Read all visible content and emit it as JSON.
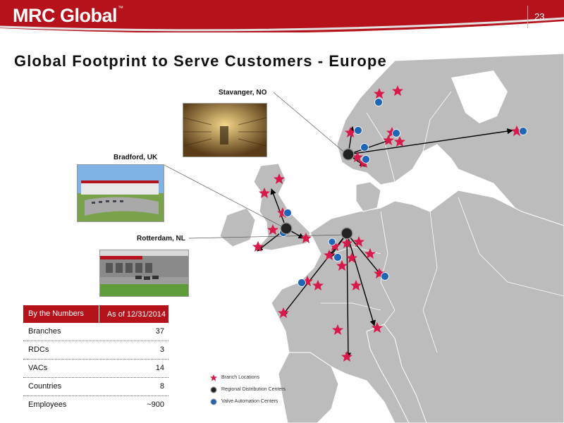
{
  "header": {
    "logo_text": "MRC Global",
    "trademark": "™",
    "page_number": "23"
  },
  "title": "Global Footprint to Serve Customers - Europe",
  "photos": {
    "stavanger": {
      "label": "Stavanger, NO"
    },
    "bradford": {
      "label": "Bradford, UK"
    },
    "rotterdam": {
      "label": "Rotterdam, NL"
    }
  },
  "stats": {
    "header_left": "By the Numbers",
    "header_right": "As of 12/31/2014",
    "rows": [
      {
        "label": "Branches",
        "value": "37"
      },
      {
        "label": "RDCs",
        "value": "3"
      },
      {
        "label": "VACs",
        "value": "14"
      },
      {
        "label": "Countries",
        "value": "8"
      },
      {
        "label": "Employees",
        "value": "~900"
      }
    ]
  },
  "legend": {
    "branch": "Branch Locations",
    "rdc": "Regional Distribution Centers",
    "vac": "Valve Automation Centers"
  },
  "colors": {
    "brand_red": "#b5121b",
    "star": "#d8194a",
    "vac": "#1f66b5",
    "land": "#bdbdbd",
    "sea": "#ffffff"
  }
}
